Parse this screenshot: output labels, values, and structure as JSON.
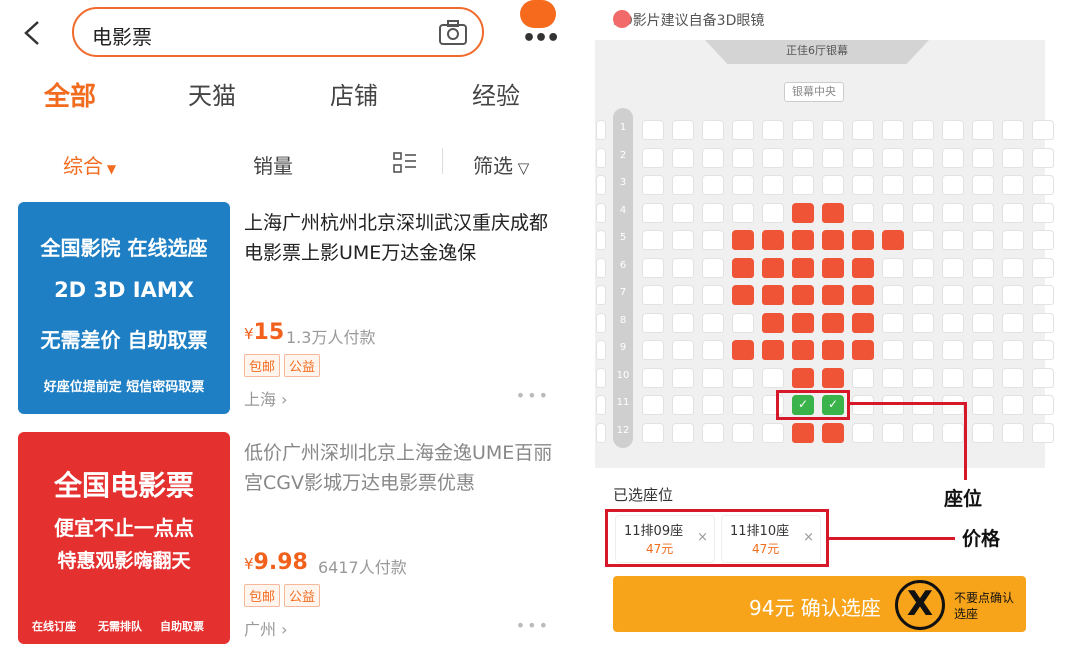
{
  "search": {
    "query": "电影票"
  },
  "tabs": [
    "全部",
    "天猫",
    "店铺",
    "经验"
  ],
  "sort": {
    "comprehensive": "综合",
    "sales": "销量",
    "filter": "筛选"
  },
  "items": [
    {
      "thumb_lines": [
        "全国影院 在线选座",
        "2D 3D IAMX",
        "无需差价 自助取票",
        "好座位提前定 短信密码取票"
      ],
      "title": "上海广州杭州北京深圳武汉重庆成都电影票上影UME万达金逸保",
      "price_symbol": "¥",
      "price": "15",
      "paid": "1.3万人付款",
      "tags": [
        "包邮",
        "公益"
      ],
      "location": "上海"
    },
    {
      "thumb_lines": [
        "全国电影票",
        "便宜不止一点点",
        "特惠观影嗨翻天",
        "在线订座",
        "无需排队",
        "自助取票"
      ],
      "title": "低价广州深圳北京上海金逸UME百丽宫CGV影城万达电影票优惠",
      "price_symbol": "¥",
      "price": "9.98",
      "paid": "6417人付款",
      "tags": [
        "包邮",
        "公益"
      ],
      "location": "广州"
    }
  ],
  "seat_view": {
    "hint": "3D影片建议自备3D眼镜",
    "screen": "正佳6厅银幕",
    "center": "银幕中央",
    "rows": [
      "1",
      "2",
      "3",
      "4",
      "5",
      "6",
      "7",
      "8",
      "9",
      "10",
      "11",
      "12"
    ],
    "selected_label": "已选座位",
    "chips": [
      {
        "seat": "11排09座",
        "price": "47元"
      },
      {
        "seat": "11排10座",
        "price": "47元"
      }
    ],
    "confirm": "94元 确认选座",
    "x_mark": "X",
    "x_note": "不要点确认选座",
    "annotations": {
      "seat": "座位",
      "price": "价格"
    }
  },
  "colors": {
    "accent": "#f26c1f",
    "sold": "#f05436",
    "selected": "#3ab34a",
    "annotation": "#d7182a",
    "confirm": "#f7a41a"
  }
}
